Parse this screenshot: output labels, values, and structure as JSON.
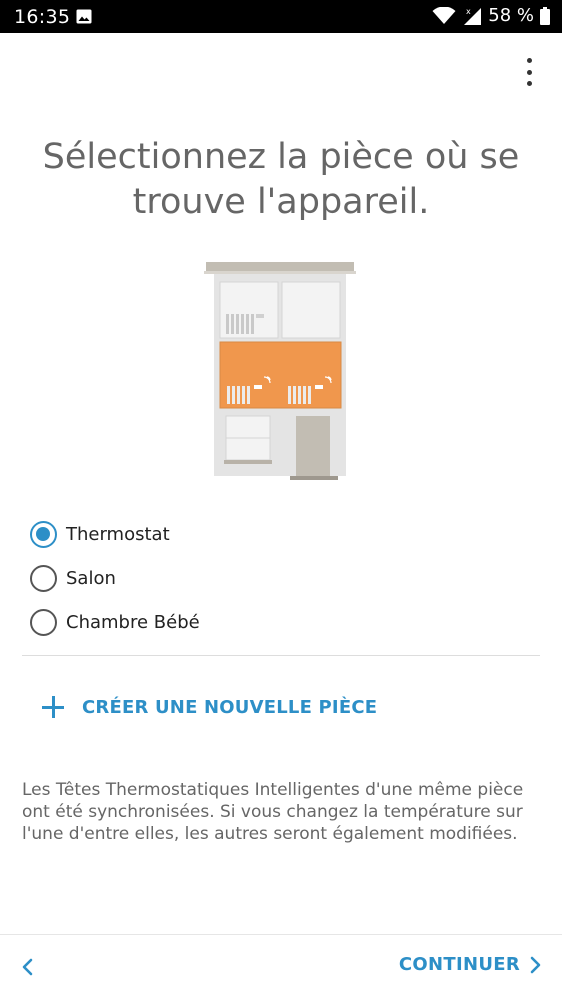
{
  "status_bar": {
    "time": "16:35",
    "battery": "58 %",
    "icons": [
      "image-icon",
      "wifi-icon",
      "signal-icon",
      "battery-icon"
    ]
  },
  "header": {
    "menu_icon": "more-vert-icon"
  },
  "main": {
    "title": "Sélectionnez la pièce où se trouve l'appareil.",
    "illustration": "house-room-illustration",
    "rooms": [
      {
        "label": "Thermostat",
        "selected": true
      },
      {
        "label": "Salon",
        "selected": false
      },
      {
        "label": "Chambre Bébé",
        "selected": false
      }
    ],
    "create_room_label": "CRÉER UNE NOUVELLE PIÈCE",
    "info_text": "Les Têtes Thermostatiques Intelligentes d'une même pièce ont été synchronisées. Si vous changez la température sur l'une d'entre elles, les autres seront également modifiées."
  },
  "footer": {
    "continue_label": "CONTINUER"
  },
  "colors": {
    "accent": "#2d8fc7",
    "highlight_room": "#f0974d",
    "title_text": "#666666"
  }
}
